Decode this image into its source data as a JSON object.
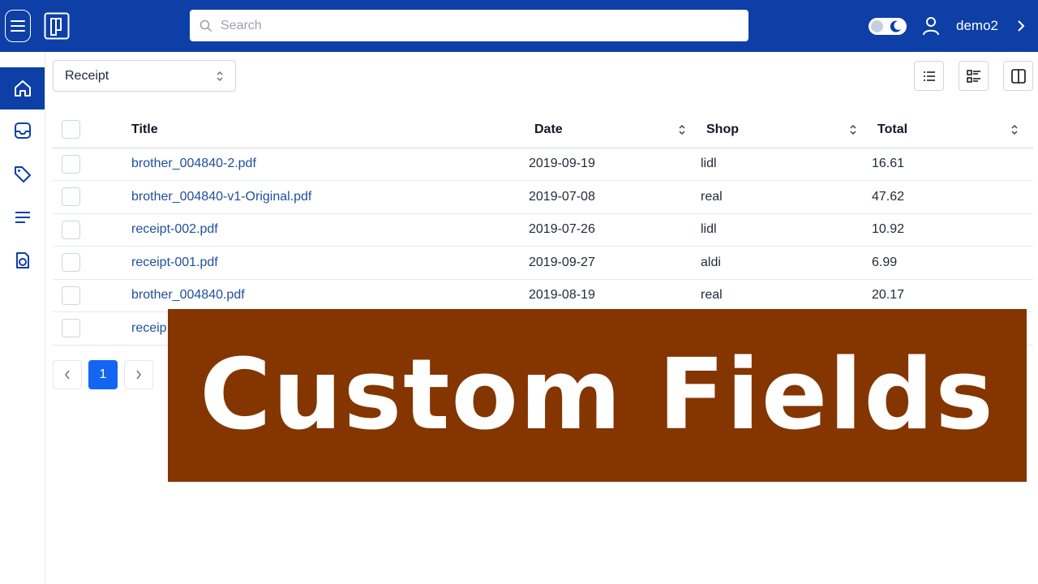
{
  "header": {
    "search_placeholder": "Search",
    "username": "demo2",
    "brand_color": "#0d3fa6",
    "icons": [
      "menu-icon",
      "logo-icon",
      "search-icon",
      "theme-toggle",
      "moon-icon",
      "user-icon",
      "chevron-right-icon"
    ]
  },
  "sidebar": {
    "items": [
      {
        "name": "home",
        "icon": "home-icon",
        "active": true
      },
      {
        "name": "inbox",
        "icon": "inbox-icon",
        "active": false
      },
      {
        "name": "tags",
        "icon": "tag-icon",
        "active": false
      },
      {
        "name": "list",
        "icon": "lines-icon",
        "active": false
      },
      {
        "name": "document-types",
        "icon": "document-icon",
        "active": false
      }
    ]
  },
  "filter": {
    "selected": "Receipt"
  },
  "view_buttons": [
    "list-view-icon",
    "detail-list-icon",
    "columns-icon"
  ],
  "table": {
    "columns": [
      "Title",
      "Date",
      "Shop",
      "Total"
    ],
    "rows": [
      {
        "title": "brother_004840-2.pdf",
        "date": "2019-09-19",
        "shop": "lidl",
        "total": "16.61"
      },
      {
        "title": "brother_004840-v1-Original.pdf",
        "date": "2019-07-08",
        "shop": "real",
        "total": "47.62"
      },
      {
        "title": "receipt-002.pdf",
        "date": "2019-07-26",
        "shop": "lidl",
        "total": "10.92"
      },
      {
        "title": "receipt-001.pdf",
        "date": "2019-09-27",
        "shop": "aldi",
        "total": "6.99"
      },
      {
        "title": "brother_004840.pdf",
        "date": "2019-08-19",
        "shop": "real",
        "total": "20.17"
      },
      {
        "title": "receip",
        "date": "",
        "shop": "",
        "total": ""
      }
    ]
  },
  "pagination": {
    "current_page": "1"
  },
  "banner": {
    "text": "Custom Fields",
    "color": "#843500"
  }
}
